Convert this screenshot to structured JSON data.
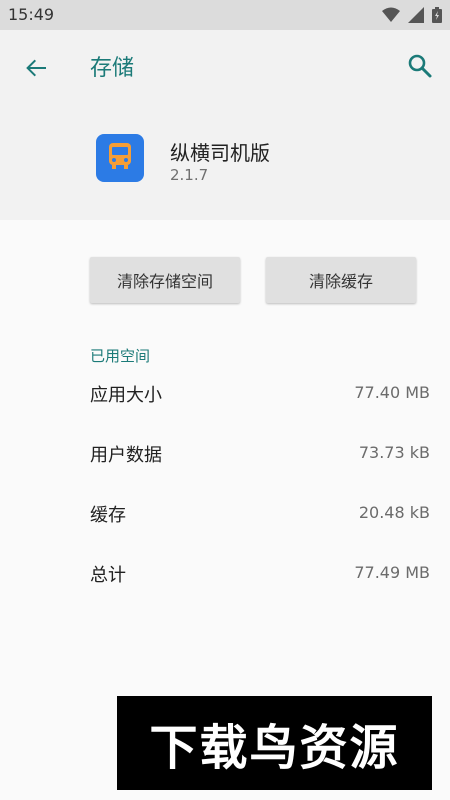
{
  "status_bar": {
    "time": "15:49"
  },
  "header": {
    "title": "存储"
  },
  "app": {
    "name": "纵横司机版",
    "version": "2.1.7"
  },
  "actions": {
    "clear_storage": "清除存储空间",
    "clear_cache": "清除缓存"
  },
  "section": {
    "title": "已用空间"
  },
  "rows": [
    {
      "label": "应用大小",
      "value": "77.40 MB"
    },
    {
      "label": "用户数据",
      "value": "73.73 kB"
    },
    {
      "label": "缓存",
      "value": "20.48 kB"
    },
    {
      "label": "总计",
      "value": "77.49 MB"
    }
  ],
  "watermark": {
    "text": "下载鸟资源"
  },
  "colors": {
    "accent": "#1b7a78",
    "app_icon_bg": "#2c7be5",
    "truck": "#f59e36"
  }
}
